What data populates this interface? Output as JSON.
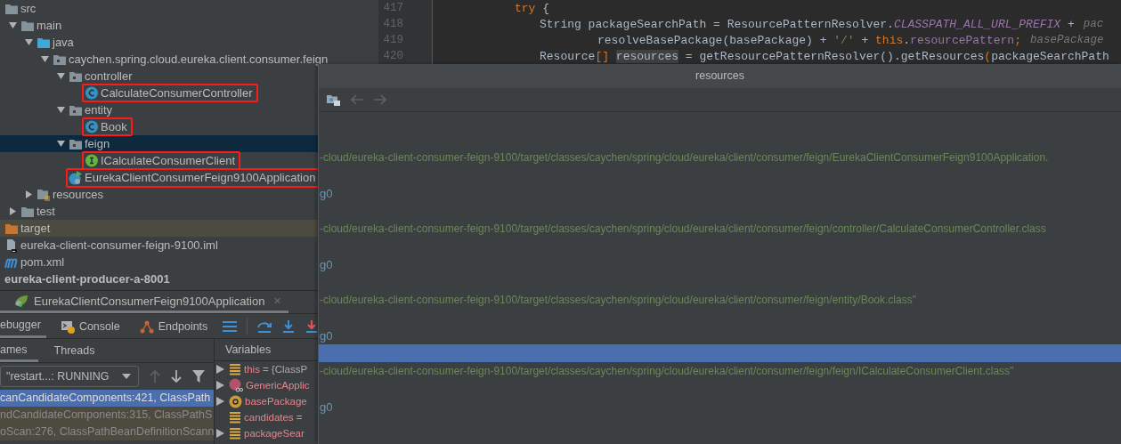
{
  "project_tree": {
    "items": [
      {
        "name": "src",
        "kind": "folder",
        "selected": false,
        "boxed": false,
        "children": [
          {
            "name": "main",
            "kind": "folder",
            "expanded": true,
            "selected": false,
            "boxed": false,
            "children": [
              {
                "name": "java",
                "kind": "source-folder",
                "expanded": true,
                "selected": false,
                "boxed": false,
                "children": [
                  {
                    "name": "caychen.spring.cloud.eureka.client.consumer.feign",
                    "kind": "package",
                    "expanded": true,
                    "selected": false,
                    "boxed": false,
                    "children": [
                      {
                        "name": "controller",
                        "kind": "package",
                        "expanded": true,
                        "selected": false,
                        "boxed": false,
                        "children": [
                          {
                            "name": "CalculateConsumerController",
                            "kind": "class",
                            "selected": false,
                            "boxed": true
                          }
                        ]
                      },
                      {
                        "name": "entity",
                        "kind": "package",
                        "expanded": true,
                        "selected": false,
                        "boxed": false,
                        "children": [
                          {
                            "name": "Book",
                            "kind": "class",
                            "selected": false,
                            "boxed": true
                          }
                        ]
                      },
                      {
                        "name": "feign",
                        "kind": "package",
                        "expanded": true,
                        "selected": true,
                        "boxed": false,
                        "children": [
                          {
                            "name": "ICalculateConsumerClient",
                            "kind": "interface",
                            "selected": false,
                            "boxed": true
                          }
                        ]
                      },
                      {
                        "name": "EurekaClientConsumerFeign9100Application",
                        "kind": "app-class",
                        "selected": false,
                        "boxed": true
                      }
                    ]
                  }
                ]
              },
              {
                "name": "resources",
                "kind": "resources-folder",
                "expanded": false,
                "selected": false,
                "boxed": false
              }
            ]
          },
          {
            "name": "test",
            "kind": "folder",
            "expanded": false,
            "selected": false,
            "boxed": false
          }
        ]
      },
      {
        "name": "target",
        "kind": "excluded-folder",
        "selected": false,
        "boxed": false
      },
      {
        "name": "eureka-client-consumer-feign-9100.iml",
        "kind": "iml-file",
        "selected": false,
        "boxed": false
      },
      {
        "name": "pom.xml",
        "kind": "maven-file",
        "selected": false,
        "boxed": false
      },
      {
        "name": "eureka-client-producer-a-8001",
        "kind": "module",
        "selected": false,
        "boxed": false
      }
    ]
  },
  "editor": {
    "lines": [
      {
        "number": "417",
        "kind": "block",
        "tokens": [
          {
            "text": "try",
            "kind": "keyword"
          },
          {
            "text": " {",
            "kind": "plain"
          }
        ]
      },
      {
        "number": "418",
        "kind": "statement",
        "tokens": [
          {
            "text": "String packageSearchPath = ResourcePatternResolver.",
            "kind": "plain"
          },
          {
            "text": "CLASSPATH_ALL_URL_PREFIX",
            "kind": "constant"
          },
          {
            "text": " +",
            "kind": "plain"
          }
        ],
        "hint": "pac"
      },
      {
        "number": "419",
        "kind": "continuation",
        "tokens": [
          {
            "text": "resolveBasePackage(basePackage) + ",
            "kind": "plain"
          },
          {
            "text": "'/'",
            "kind": "string"
          },
          {
            "text": " + ",
            "kind": "plain"
          },
          {
            "text": "this",
            "kind": "keyword"
          },
          {
            "text": ".",
            "kind": "plain"
          },
          {
            "text": "resourcePattern",
            "kind": "field"
          },
          {
            "text": ";",
            "kind": "keyword"
          }
        ],
        "hint": "basePackage"
      },
      {
        "number": "420",
        "kind": "statement",
        "tokens": [
          {
            "text": "Resource",
            "kind": "plain"
          },
          {
            "text": "[] ",
            "kind": "keyword"
          },
          {
            "text": "resources",
            "kind": "usage"
          },
          {
            "text": " = getResourcePatternResolver().getResources",
            "kind": "plain"
          },
          {
            "text": "(",
            "kind": "keyword"
          },
          {
            "text": "packageSearchPath",
            "kind": "plain"
          }
        ]
      }
    ]
  },
  "debug": {
    "session_tab": {
      "title": "EurekaClientConsumerFeign9100Application",
      "close": "×"
    },
    "tabs": [
      {
        "label": "ebugger",
        "kind": "plain",
        "selected": true
      },
      {
        "label": "Console",
        "kind": "console",
        "selected": false
      },
      {
        "label": "Endpoints",
        "kind": "endpoints",
        "selected": false
      }
    ],
    "frames_tabs": [
      {
        "label": "ames",
        "selected": true
      },
      {
        "label": "Threads",
        "selected": false
      }
    ],
    "variables_header": "Variables",
    "thread": "\"restart...: RUNNING",
    "frames": [
      {
        "text": "canCandidateComponents:421, ClassPath",
        "selected": true
      },
      {
        "text": "ndCandidateComponents:315, ClassPathS",
        "selected": false
      },
      {
        "text": "oScan:276, ClassPathBeanDefinitionScann",
        "selected": false
      }
    ],
    "variables": [
      {
        "name": "this",
        "value": "= {ClassP",
        "kind": "field",
        "expandable": true
      },
      {
        "name": "GenericApplic",
        "kind": "method",
        "expandable": true
      },
      {
        "name": "basePackage",
        "kind": "parameter",
        "expandable": true
      },
      {
        "name": "candidates",
        "value": "=",
        "kind": "field",
        "expandable": false
      },
      {
        "name": "packageSear",
        "kind": "field",
        "expandable": true
      }
    ]
  },
  "popup": {
    "title": "resources",
    "rows": [
      {
        "kind": "blank",
        "selected": false
      },
      {
        "kind": "blank",
        "selected": false
      },
      {
        "kind": "path",
        "text": "-cloud/eureka-client-consumer-feign-9100/target/classes/caychen/spring/cloud/eureka/client/consumer/feign/EurekaClientConsumerFeign9100Application.",
        "selected": false
      },
      {
        "kind": "blank",
        "selected": false
      },
      {
        "kind": "name",
        "text": "g0",
        "selected": false
      },
      {
        "kind": "blank",
        "selected": false
      },
      {
        "kind": "path",
        "text": "-cloud/eureka-client-consumer-feign-9100/target/classes/caychen/spring/cloud/eureka/client/consumer/feign/controller/CalculateConsumerController.class",
        "selected": false
      },
      {
        "kind": "blank",
        "selected": false
      },
      {
        "kind": "name",
        "text": "g0",
        "selected": false
      },
      {
        "kind": "blank",
        "selected": false
      },
      {
        "kind": "path",
        "text": "-cloud/eureka-client-consumer-feign-9100/target/classes/caychen/spring/cloud/eureka/client/consumer/feign/entity/Book.class\"",
        "selected": false
      },
      {
        "kind": "blank",
        "selected": false
      },
      {
        "kind": "name",
        "text": "g0",
        "selected": false
      },
      {
        "kind": "blank",
        "selected": true
      },
      {
        "kind": "path",
        "text": "-cloud/eureka-client-consumer-feign-9100/target/classes/caychen/spring/cloud/eureka/client/consumer/feign/feign/ICalculateConsumerClient.class\"",
        "selected": false
      },
      {
        "kind": "blank",
        "selected": false
      },
      {
        "kind": "name",
        "text": "g0",
        "selected": false
      },
      {
        "kind": "blank",
        "selected": false
      }
    ]
  }
}
